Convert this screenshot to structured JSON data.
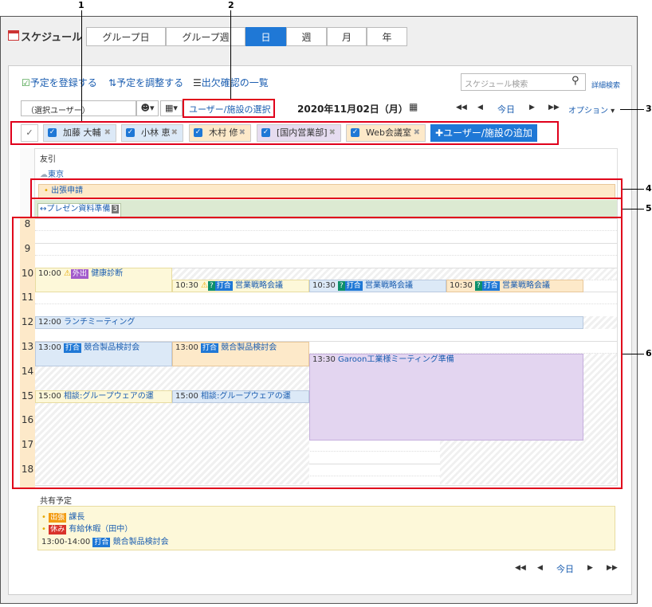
{
  "app": {
    "title": "スケジュール"
  },
  "tabs": [
    {
      "label": "グループ日",
      "active": false
    },
    {
      "label": "グループ週",
      "active": false
    },
    {
      "label": "日",
      "active": true
    },
    {
      "label": "週",
      "active": false
    },
    {
      "label": "月",
      "active": false
    },
    {
      "label": "年",
      "active": false
    }
  ],
  "toolbar": {
    "register": "予定を登録する",
    "adjust": "予定を調整する",
    "attendance": "出欠確認の一覧",
    "search_placeholder": "スケジュール検索",
    "advanced_search": "詳細検索",
    "user_select_placeholder": "（選択ユーザー）",
    "user_facility_select": "ユーザー/施設の選択",
    "date": "2020年11月02日（月）",
    "today": "今日",
    "options": "オプション"
  },
  "selected_users": [
    {
      "name": "加藤 大輔",
      "color": "#dce9f7"
    },
    {
      "name": "小林 恵",
      "color": "#dce9f7"
    },
    {
      "name": "木村 修",
      "color": "#fde9c9"
    },
    {
      "name": "[国内営業部]",
      "color": "#e6dcf0"
    },
    {
      "name": "Web会議室",
      "color": "#fde9c9"
    }
  ],
  "add_user_button": "ユーザー/施設の追加",
  "day_info": {
    "rokuyo": "友引",
    "weather_city": "東京"
  },
  "banner_event": "出張申請",
  "task_bar": {
    "label": "↔プレゼン資料準備",
    "count": "3"
  },
  "hours": [
    "8",
    "9",
    "10",
    "11",
    "12",
    "13",
    "14",
    "15",
    "16",
    "17",
    "18"
  ],
  "events": {
    "e1": {
      "time": "10:00",
      "badge": "外出",
      "title": "健康診断"
    },
    "e2": {
      "time": "10:30",
      "badge": "打合",
      "title": "営業戦略会議"
    },
    "e3": {
      "time": "10:30",
      "badge": "打合",
      "title": "営業戦略会議"
    },
    "e4": {
      "time": "10:30",
      "badge": "打合",
      "title": "営業戦略会議"
    },
    "e5": {
      "time": "12:00",
      "title": "ランチミーティング"
    },
    "e6": {
      "time": "13:00",
      "badge": "打合",
      "title": "競合製品検討会"
    },
    "e7": {
      "time": "13:00",
      "badge": "打合",
      "title": "競合製品検討会"
    },
    "e8": {
      "time": "13:30",
      "title": "Garoon工業様ミーティング準備"
    },
    "e9": {
      "time": "15:00",
      "title": "相談:グループウェアの運"
    },
    "e10": {
      "time": "15:00",
      "title": "相談:グループウェアの運"
    }
  },
  "shared": {
    "heading": "共有予定",
    "items": [
      {
        "badge": "出張",
        "text": "課長"
      },
      {
        "badge": "休み",
        "text": "有給休暇（田中）"
      },
      {
        "time": "13:00-14:00",
        "badge": "打合",
        "text": "競合製品検討会"
      }
    ]
  },
  "callouts": [
    "1",
    "2",
    "3",
    "4",
    "5",
    "6"
  ]
}
